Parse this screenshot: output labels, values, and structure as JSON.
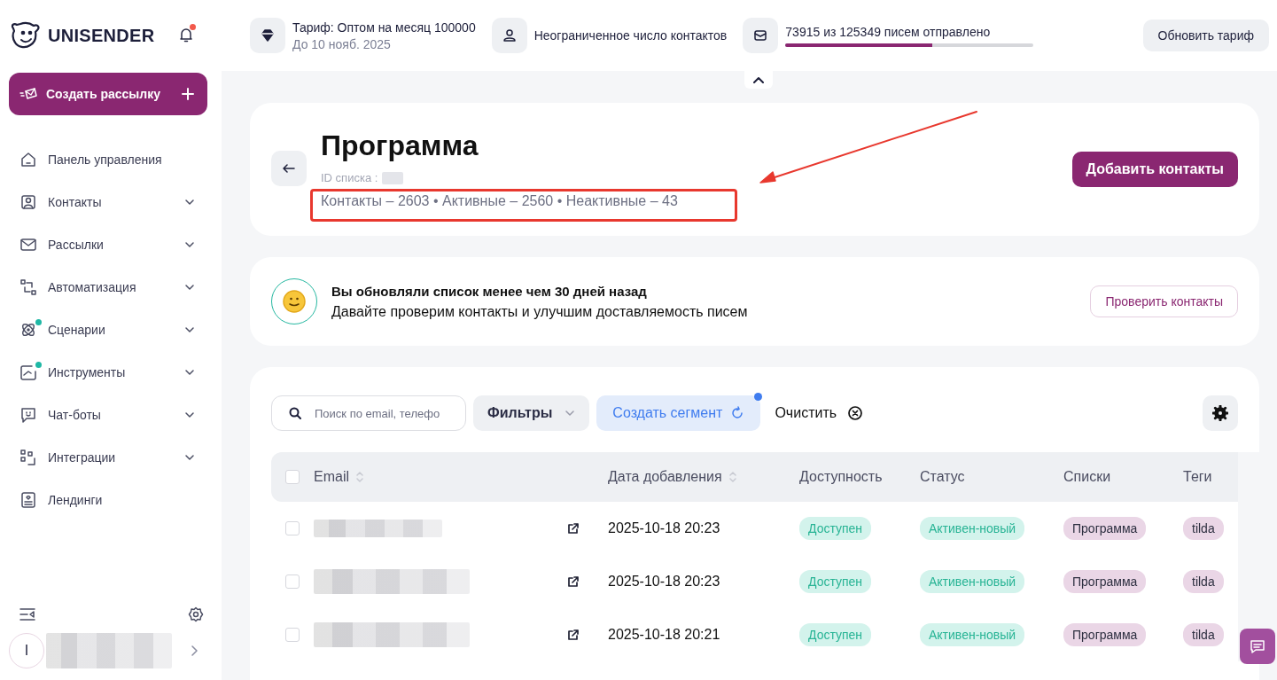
{
  "header": {
    "logo": "UNISENDER",
    "notifications": {
      "unread": true
    },
    "plan": {
      "title": "Тариф: Оптом на месяц 100000",
      "until": "До 10 нояб. 2025"
    },
    "contacts_limit": "Неограниченное число контактов",
    "emails": {
      "text": "73915 из 125349 писем отправлено",
      "level": 0.59
    },
    "upgrade_button": "Обновить тариф"
  },
  "sidebar": {
    "create_button": "Создать рассылку",
    "items": [
      {
        "label": "Панель управления",
        "expandable": false,
        "new_dot": false
      },
      {
        "label": "Контакты",
        "expandable": true,
        "new_dot": false
      },
      {
        "label": "Рассылки",
        "expandable": true,
        "new_dot": false
      },
      {
        "label": "Автоматизация",
        "expandable": true,
        "new_dot": false
      },
      {
        "label": "Сценарии",
        "expandable": true,
        "new_dot": true
      },
      {
        "label": "Инструменты",
        "expandable": true,
        "new_dot": true
      },
      {
        "label": "Чат-боты",
        "expandable": true,
        "new_dot": false
      },
      {
        "label": "Интеграции",
        "expandable": true,
        "new_dot": false
      },
      {
        "label": "Лендинги",
        "expandable": false,
        "new_dot": false
      }
    ],
    "user": {
      "initial": "I"
    }
  },
  "list_header": {
    "title": "Программа",
    "id_label": "ID списка :",
    "stats": "Контакты – 2603 • Активные – 2560 • Неактивные – 43",
    "add_button": "Добавить контакты"
  },
  "notice": {
    "title": "Вы обновляли список менее чем 30 дней назад",
    "text": "Давайте проверим контакты и улучшим доставляемость писем",
    "button": "Проверить контакты"
  },
  "toolbar": {
    "search_placeholder": "Поиск по email, телефо",
    "filters": "Фильтры",
    "segment": {
      "label": "Создать сегмент",
      "badge": true
    },
    "clear": "Очистить"
  },
  "table": {
    "all_checked": false,
    "columns": [
      {
        "label": "Email",
        "sortable": true
      },
      {
        "label": "Дата добавления",
        "sortable": true
      },
      {
        "label": "Доступность",
        "sortable": false
      },
      {
        "label": "Статус",
        "sortable": false
      },
      {
        "label": "Списки",
        "sortable": false
      },
      {
        "label": "Теги",
        "sortable": false
      }
    ],
    "rows": [
      {
        "checked": false,
        "date": "2025-10-18 20:23",
        "availability": "Доступен",
        "status": "Активен-новый",
        "list": "Программа",
        "tag": "tilda"
      },
      {
        "checked": false,
        "date": "2025-10-18 20:23",
        "availability": "Доступен",
        "status": "Активен-новый",
        "list": "Программа",
        "tag": "tilda"
      },
      {
        "checked": false,
        "date": "2025-10-18 20:21",
        "availability": "Доступен",
        "status": "Активен-новый",
        "list": "Программа",
        "tag": "tilda"
      }
    ]
  }
}
